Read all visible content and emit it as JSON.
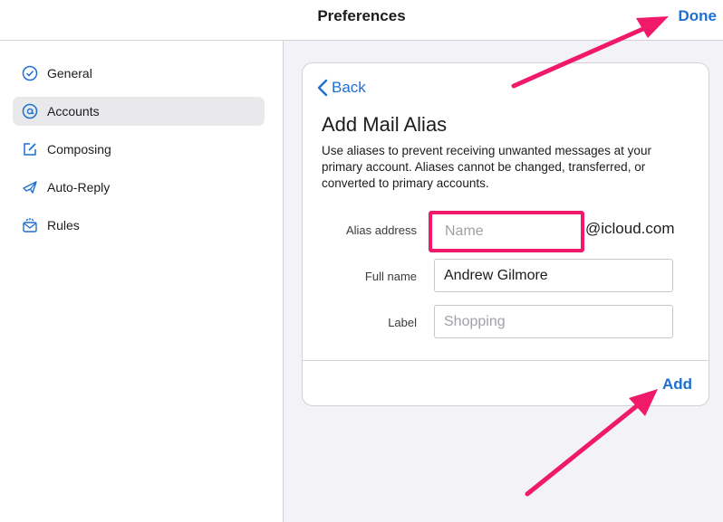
{
  "header": {
    "title": "Preferences",
    "done_label": "Done"
  },
  "sidebar": {
    "items": [
      {
        "label": "General",
        "icon": "checkmark-circle-icon",
        "active": false
      },
      {
        "label": "Accounts",
        "icon": "at-sign-icon",
        "active": true
      },
      {
        "label": "Composing",
        "icon": "compose-icon",
        "active": false
      },
      {
        "label": "Auto-Reply",
        "icon": "airplane-icon",
        "active": false
      },
      {
        "label": "Rules",
        "icon": "envelope-rules-icon",
        "active": false
      }
    ]
  },
  "dialog": {
    "back_label": "Back",
    "title": "Add Mail Alias",
    "description": "Use aliases to prevent receiving unwanted messages at your primary account. Aliases cannot be changed, transferred, or converted to primary accounts.",
    "fields": {
      "alias": {
        "label": "Alias address",
        "value": "",
        "placeholder": "Name",
        "suffix": "@icloud.com"
      },
      "fullname": {
        "label": "Full name",
        "value": "Andrew Gilmore",
        "placeholder": ""
      },
      "label": {
        "label": "Label",
        "value": "",
        "placeholder": "Shopping"
      }
    },
    "add_label": "Add"
  },
  "colors": {
    "accent": "#1f6fd1",
    "highlight": "#f0196a",
    "sidebar_active": "#e9e9ec",
    "background": "#f2f2f7"
  }
}
